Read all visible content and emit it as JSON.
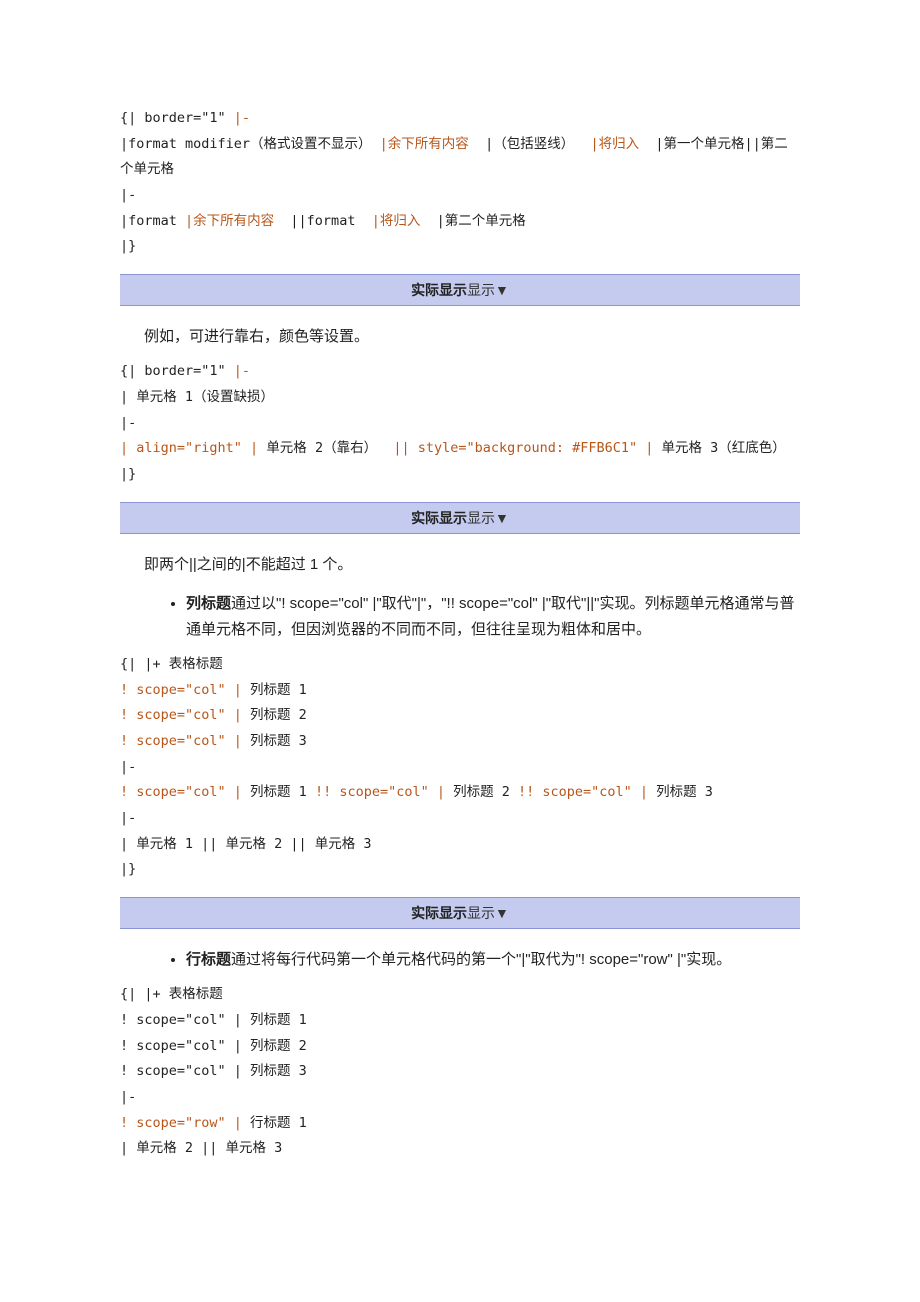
{
  "block1": {
    "l1a": "{| border=\"1\" ",
    "l1b": "|-",
    "l2a": "|format modifier（格式设置不显示） ",
    "l2b": "|余下所有内容  ",
    "l2c": "|（包括竖线）  ",
    "l2d": "|将归入  ",
    "l2e": "|第一个单元格||第二个单元格",
    "l3": "|-",
    "l4a": "|format ",
    "l4b": "|余下所有内容  ",
    "l4c": "||format  ",
    "l4d": "|将归入  ",
    "l4e": "|第二个单元格",
    "l5": "|}"
  },
  "banner": {
    "bold": "实际显示",
    "norm": "显示▼"
  },
  "para1": "例如，可进行靠右，颜色等设置。",
  "block2": {
    "l1a": "{| border=\"1\" ",
    "l1b": "|-",
    "l2": "| 单元格 1（设置缺损）",
    "l3": "|-",
    "l4a": "| align=\"right\" | ",
    "l4b": "单元格 2（靠右）  ",
    "l4c": "|| style=\"background: #FFB6C1\" | ",
    "l4d": "单元格 3（红底色）",
    "l5": "|}"
  },
  "para2": "即两个||之间的|不能超过 1 个。",
  "bullet1": {
    "term": "列标题",
    "rest": "通过以\"! scope=\"col\" |\"取代\"|\"，\"!! scope=\"col\" |\"取代\"||\"实现。列标题单元格通常与普通单元格不同，但因浏览器的不同而不同，但往往呈现为粗体和居中。"
  },
  "block3": {
    "l1": "{| |+ 表格标题",
    "l2a": "! scope=\"col\" | ",
    "l2b": "列标题 1",
    "l3a": "! scope=\"col\" | ",
    "l3b": "列标题 2",
    "l4a": "! scope=\"col\" | ",
    "l4b": "列标题 3",
    "l5": "|-",
    "l6a": "! scope=\"col\" | ",
    "l6b": "列标题 1 ",
    "l6c": "!! scope=\"col\" | ",
    "l6d": "列标题 2 ",
    "l6e": "!! scope=\"col\" | ",
    "l6f": "列标题 3",
    "l7": "|-",
    "l8": "| 单元格 1 || 单元格 2 || 单元格 3",
    "l9": "|}"
  },
  "bullet2": {
    "term": "行标题",
    "rest": "通过将每行代码第一个单元格代码的第一个\"|\"取代为\"! scope=\"row\" |\"实现。"
  },
  "block4": {
    "l1": "{| |+ 表格标题",
    "l2": "! scope=\"col\" | 列标题 1",
    "l3": "! scope=\"col\" | 列标题 2",
    "l4": "! scope=\"col\" | 列标题 3",
    "l5": "|-",
    "l6a": "! scope=\"row\" | ",
    "l6b": "行标题 1",
    "l7": "| 单元格 2 || 单元格 3"
  }
}
